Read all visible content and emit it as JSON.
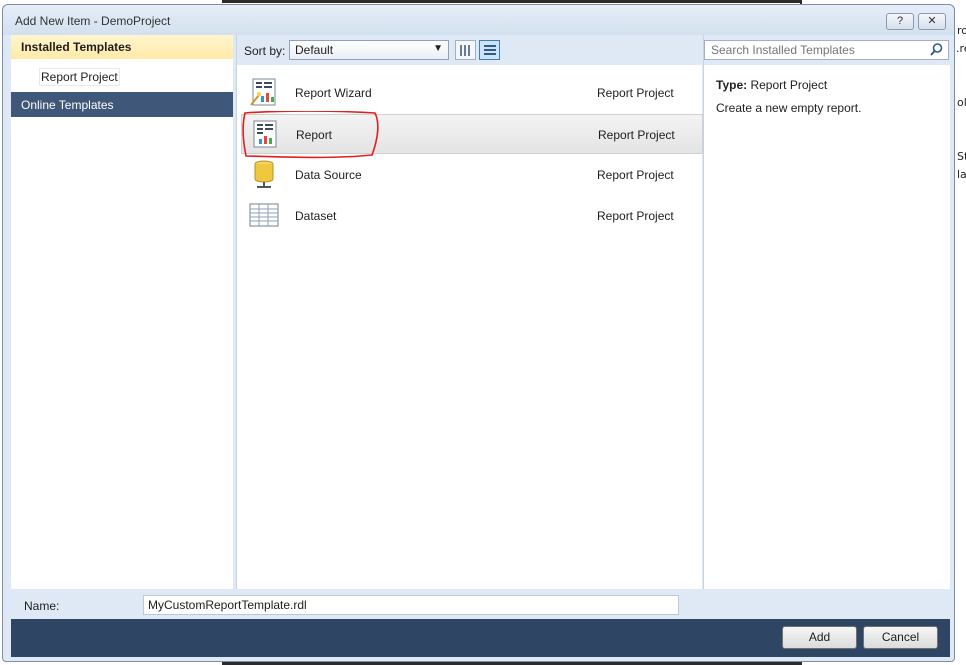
{
  "window": {
    "title": "Add New Item - DemoProject",
    "help_glyph": "?",
    "close_glyph": "✕"
  },
  "left_panel": {
    "installed_header": "Installed Templates",
    "installed_items": [
      {
        "label": "Report Project"
      }
    ],
    "online_header": "Online Templates"
  },
  "toolbar": {
    "sort_label": "Sort by:",
    "sort_value": "Default"
  },
  "templates": [
    {
      "name": "Report Wizard",
      "type": "Report Project",
      "icon": "report-wizard-icon",
      "selected": false
    },
    {
      "name": "Report",
      "type": "Report Project",
      "icon": "report-icon",
      "selected": true
    },
    {
      "name": "Data Source",
      "type": "Report Project",
      "icon": "data-source-icon",
      "selected": false
    },
    {
      "name": "Dataset",
      "type": "Report Project",
      "icon": "dataset-icon",
      "selected": false
    }
  ],
  "search": {
    "placeholder": "Search Installed Templates"
  },
  "details": {
    "type_label": "Type:",
    "type_value": "Report Project",
    "description": "Create a new empty report."
  },
  "footer": {
    "name_label": "Name:",
    "name_value": "MyCustomReportTemplate.rdl",
    "add_label": "Add",
    "cancel_label": "Cancel"
  },
  "background_fragments": [
    "ro",
    ".re",
    "ol",
    "St",
    "la"
  ],
  "colors": {
    "selected_header": "#ffe9a8",
    "online_header": "#3f5778",
    "button_bar": "#2e4563",
    "annotation": "#e02020"
  }
}
